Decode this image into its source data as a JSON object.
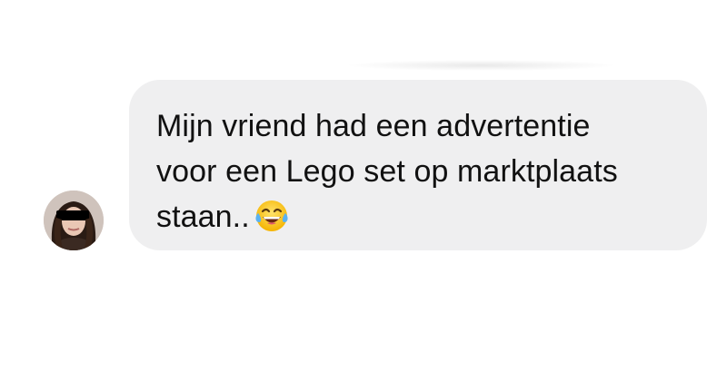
{
  "conversation": {
    "message": {
      "lines": [
        "Mijn vriend had een advertentie",
        "voor een Lego set op marktplaats",
        "staan.."
      ],
      "emoji": "face-with-tears-of-joy-icon",
      "sender_avatar": "profile-photo-censored"
    }
  },
  "colors": {
    "bubble_background": "#efeff0",
    "text": "#111111",
    "page_background": "#ffffff"
  }
}
